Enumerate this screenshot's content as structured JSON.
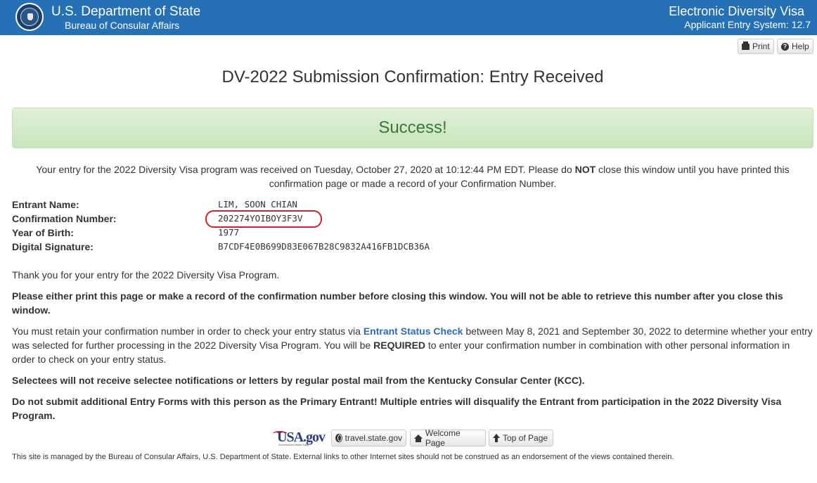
{
  "header": {
    "title": "U.S. Department of State",
    "subtitle": "Bureau of Consular Affairs",
    "right_title": "Electronic Diversity Visa",
    "right_subtitle": "Applicant Entry System: 12.7"
  },
  "toolbar": {
    "print_label": "Print",
    "help_label": "Help"
  },
  "page_title": "DV-2022 Submission Confirmation: Entry Received",
  "success_text": "Success!",
  "notice": {
    "before": "Your entry for the 2022 Diversity Visa program was received on Tuesday, October 27, 2020 at 10:12:44 PM EDT. Please do ",
    "emphasis": "NOT",
    "after": " close this window until you have printed this confirmation page or made a record of your Confirmation Number."
  },
  "entrant": {
    "name_label": "Entrant Name:",
    "name_value": "LIM, SOON CHIAN",
    "confirmation_label": "Confirmation Number:",
    "confirmation_value": "202274YOIBOY3F3V",
    "birth_label": "Year of Birth:",
    "birth_value": "1977",
    "signature_label": "Digital Signature:",
    "signature_value": "B7CDF4E0B699D83E067B28C9832A416FB1DCB36A"
  },
  "paragraphs": {
    "thanks": "Thank you for your entry for the 2022 Diversity Visa Program.",
    "print_warning": "Please either print this page or make a record of the confirmation number before closing this window. You will not be able to retrieve this number after you close this window.",
    "retain_before": "You must retain your confirmation number in order to check your entry status via ",
    "retain_link": "Entrant Status Check",
    "retain_middle": " between May 8, 2021 and September 30, 2022 to determine whether your entry was selected for further processing in the 2022 Diversity Visa Program. You will be ",
    "retain_emphasis": "REQUIRED",
    "retain_after": " to enter your confirmation number in combination with other personal information in order to check on your entry status.",
    "selectees": "Selectees will not receive selectee notifications or letters by regular postal mail from the Kentucky Consular Center (KCC).",
    "multiple": "Do not submit additional Entry Forms with this person as the Primary Entrant! Multiple entries will disqualify the Entrant from participation in the 2022 Diversity Visa Program."
  },
  "bottom_links": {
    "usa_gov": "USA.gov",
    "usa_gov_tagline": "Government Made Easy",
    "travel": "travel.state.gov",
    "welcome": "Welcome Page",
    "top": "Top of Page"
  },
  "footer": "This site is managed by the Bureau of Consular Affairs, U.S. Department of State. External links to other Internet sites should not be construed as an endorsement of the views contained therein.",
  "colors": {
    "header_blue": "#2670b5",
    "success_green": "#3c763d",
    "highlight_red": "#d11f2a",
    "link_blue": "#2a6db3"
  }
}
